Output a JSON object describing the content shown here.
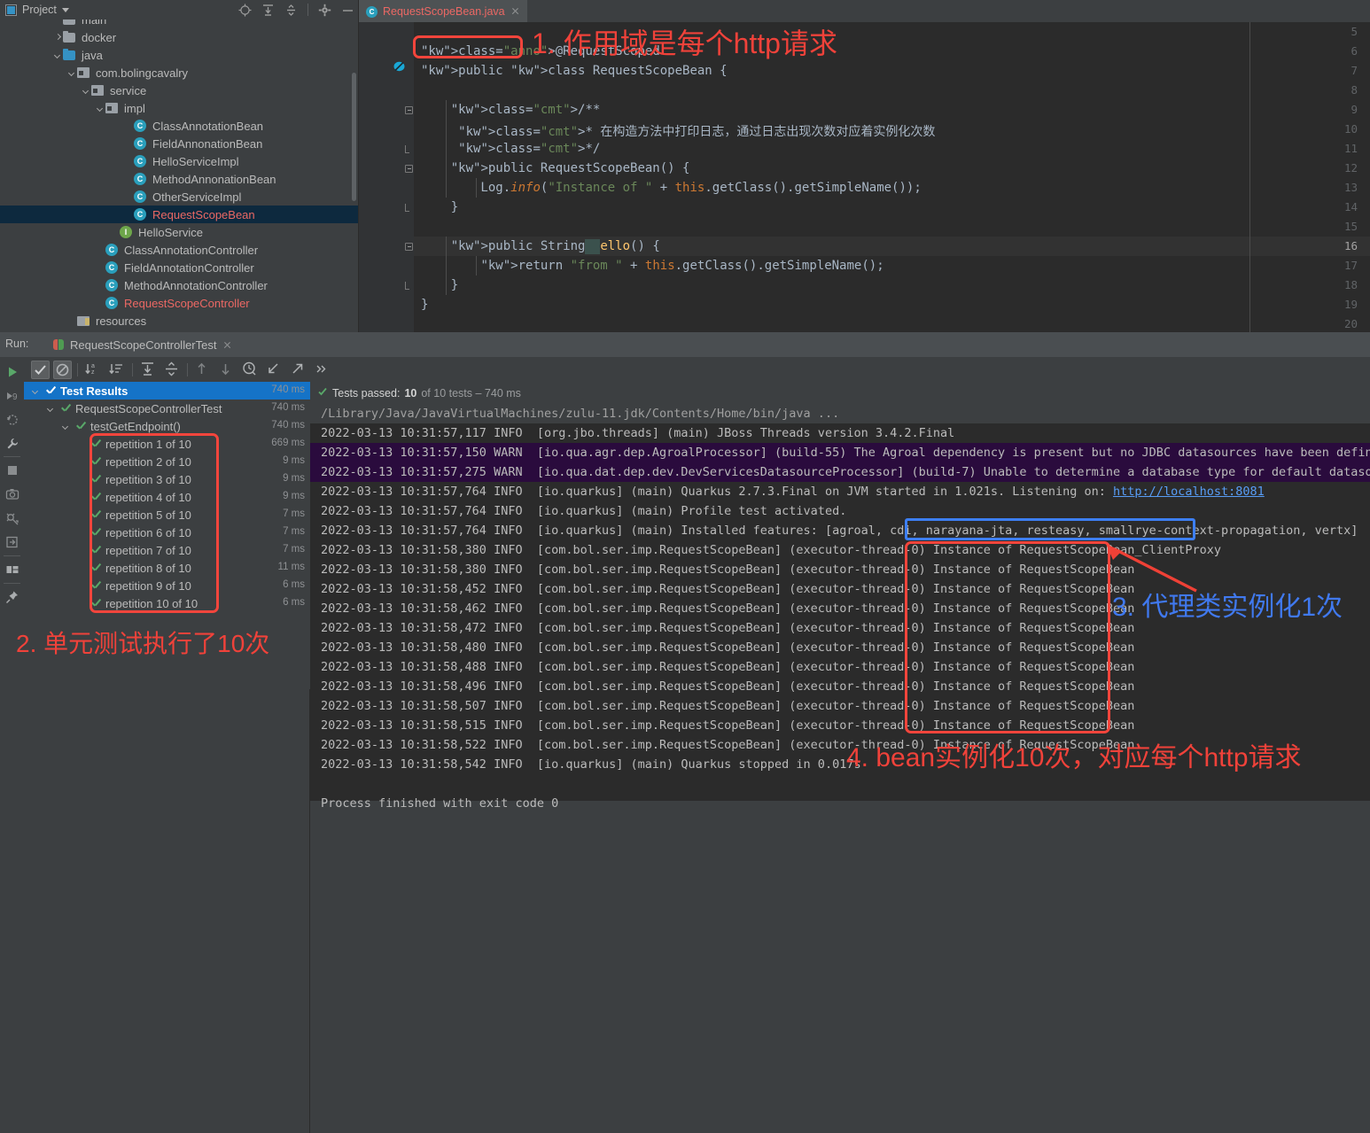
{
  "project_panel": {
    "title": "Project",
    "icons": [
      "locate-icon",
      "expand-all-icon",
      "collapse-all-icon",
      "gear-icon",
      "minimize-icon"
    ],
    "tree": [
      {
        "label": "main",
        "indent": 3,
        "icon": "folder",
        "arrow": "none",
        "cut": true,
        "color": "normal"
      },
      {
        "label": "docker",
        "indent": 3,
        "icon": "folder",
        "arrow": "right",
        "color": "normal"
      },
      {
        "label": "java",
        "indent": 3,
        "icon": "folder-blue",
        "arrow": "down",
        "color": "normal"
      },
      {
        "label": "com.bolingcavalry",
        "indent": 4,
        "icon": "package",
        "arrow": "down",
        "color": "normal"
      },
      {
        "label": "service",
        "indent": 5,
        "icon": "package",
        "arrow": "down",
        "color": "normal"
      },
      {
        "label": "impl",
        "indent": 6,
        "icon": "package",
        "arrow": "down",
        "color": "normal"
      },
      {
        "label": "ClassAnnotationBean",
        "indent": 8,
        "icon": "class",
        "arrow": "none",
        "color": "normal"
      },
      {
        "label": "FieldAnnonationBean",
        "indent": 8,
        "icon": "class",
        "arrow": "none",
        "color": "normal"
      },
      {
        "label": "HelloServiceImpl",
        "indent": 8,
        "icon": "class",
        "arrow": "none",
        "color": "normal"
      },
      {
        "label": "MethodAnnonationBean",
        "indent": 8,
        "icon": "class",
        "arrow": "none",
        "color": "normal"
      },
      {
        "label": "OtherServiceImpl",
        "indent": 8,
        "icon": "class",
        "arrow": "none",
        "color": "normal"
      },
      {
        "label": "RequestScopeBean",
        "indent": 8,
        "icon": "class",
        "arrow": "none",
        "color": "red",
        "selected": true
      },
      {
        "label": "HelloService",
        "indent": 7,
        "icon": "interface",
        "arrow": "none",
        "color": "normal"
      },
      {
        "label": "ClassAnnotationController",
        "indent": 6,
        "icon": "class",
        "arrow": "none",
        "color": "normal"
      },
      {
        "label": "FieldAnnotationController",
        "indent": 6,
        "icon": "class",
        "arrow": "none",
        "color": "normal"
      },
      {
        "label": "MethodAnnotationController",
        "indent": 6,
        "icon": "class",
        "arrow": "none",
        "color": "normal"
      },
      {
        "label": "RequestScopeController",
        "indent": 6,
        "icon": "class",
        "arrow": "none",
        "color": "red"
      },
      {
        "label": "resources",
        "indent": 4,
        "icon": "resources",
        "arrow": "none",
        "color": "normal"
      }
    ]
  },
  "editor": {
    "tab_label": "RequestScopeBean.java",
    "tab_icon": "class-icon",
    "first_line_number": 5,
    "current_line": 16,
    "lines": [
      {
        "n": 5,
        "text": ""
      },
      {
        "n": 6,
        "text": "@RequestScoped"
      },
      {
        "n": 7,
        "text": "public class RequestScopeBean {"
      },
      {
        "n": 8,
        "text": ""
      },
      {
        "n": 9,
        "text": "    /**"
      },
      {
        "n": 10,
        "text": "     * 在构造方法中打印日志，通过日志出现次数对应着实例化次数"
      },
      {
        "n": 11,
        "text": "     */"
      },
      {
        "n": 12,
        "text": "    public RequestScopeBean() {"
      },
      {
        "n": 13,
        "text": "        Log.info(\"Instance of \" + this.getClass().getSimpleName());"
      },
      {
        "n": 14,
        "text": "    }"
      },
      {
        "n": 15,
        "text": ""
      },
      {
        "n": 16,
        "text": "    public String hello() {"
      },
      {
        "n": 17,
        "text": "        return \"from \" + this.getClass().getSimpleName();"
      },
      {
        "n": 18,
        "text": "    }"
      },
      {
        "n": 19,
        "text": "}"
      },
      {
        "n": 20,
        "text": ""
      }
    ]
  },
  "run_panel": {
    "run_label": "Run:",
    "tab_name": "RequestScopeControllerTest",
    "toolbar_icons": [
      "show-passed-toggle",
      "hide-ignored-toggle",
      "sort-alphabetically",
      "sort-by-duration",
      "expand-all",
      "collapse-all",
      "prev-failed",
      "next-failed",
      "history",
      "import-tests",
      "export-tests",
      "more"
    ],
    "left_strip_icons": [
      "rerun-icon",
      "rerun-failed-icon",
      "rerun-automatically-icon",
      "settings-wrench-icon",
      "stop-icon",
      "screenshot-icon",
      "dump-threads-icon",
      "exit-icon",
      "layout-icon",
      "pin-icon"
    ],
    "status_text_prefix": "Tests passed:",
    "status_count": "10",
    "status_text_suffix": "of 10 tests – 740 ms",
    "results": [
      {
        "label": "Test Results",
        "time": "740 ms",
        "indent": 0,
        "arrow": "down",
        "selected": true
      },
      {
        "label": "RequestScopeControllerTest",
        "time": "740 ms",
        "indent": 1,
        "arrow": "down",
        "selected": false
      },
      {
        "label": "testGetEndpoint()",
        "time": "740 ms",
        "indent": 2,
        "arrow": "down",
        "selected": false
      },
      {
        "label": "repetition 1 of 10",
        "time": "669 ms",
        "indent": 3,
        "arrow": "none",
        "selected": false
      },
      {
        "label": "repetition 2 of 10",
        "time": "9 ms",
        "indent": 3,
        "arrow": "none",
        "selected": false
      },
      {
        "label": "repetition 3 of 10",
        "time": "9 ms",
        "indent": 3,
        "arrow": "none",
        "selected": false
      },
      {
        "label": "repetition 4 of 10",
        "time": "9 ms",
        "indent": 3,
        "arrow": "none",
        "selected": false
      },
      {
        "label": "repetition 5 of 10",
        "time": "7 ms",
        "indent": 3,
        "arrow": "none",
        "selected": false
      },
      {
        "label": "repetition 6 of 10",
        "time": "7 ms",
        "indent": 3,
        "arrow": "none",
        "selected": false
      },
      {
        "label": "repetition 7 of 10",
        "time": "7 ms",
        "indent": 3,
        "arrow": "none",
        "selected": false
      },
      {
        "label": "repetition 8 of 10",
        "time": "11 ms",
        "indent": 3,
        "arrow": "none",
        "selected": false
      },
      {
        "label": "repetition 9 of 10",
        "time": "6 ms",
        "indent": 3,
        "arrow": "none",
        "selected": false
      },
      {
        "label": "repetition 10 of 10",
        "time": "6 ms",
        "indent": 3,
        "arrow": "none",
        "selected": false
      }
    ]
  },
  "console": {
    "lines": [
      {
        "style": "first",
        "text": "/Library/Java/JavaVirtualMachines/zulu-11.jdk/Contents/Home/bin/java ..."
      },
      {
        "style": "info",
        "text": "2022-03-13 10:31:57,117 INFO  [org.jbo.threads] (main) JBoss Threads version 3.4.2.Final"
      },
      {
        "style": "warn",
        "text": "2022-03-13 10:31:57,150 WARN  [io.qua.agr.dep.AgroalProcessor] (build-55) The Agroal dependency is present but no JDBC datasources have been defined."
      },
      {
        "style": "warn",
        "text": "2022-03-13 10:31:57,275 WARN  [io.qua.dat.dep.dev.DevServicesDatasourceProcessor] (build-7) Unable to determine a database type for default datasource"
      },
      {
        "style": "link",
        "prefix": "2022-03-13 10:31:57,764 INFO  [io.quarkus] (main) Quarkus 2.7.3.Final on JVM started in 1.021s. Listening on: ",
        "link": "http://localhost:8081"
      },
      {
        "style": "info",
        "text": "2022-03-13 10:31:57,764 INFO  [io.quarkus] (main) Profile test activated."
      },
      {
        "style": "info",
        "text": "2022-03-13 10:31:57,764 INFO  [io.quarkus] (main) Installed features: [agroal, cdi, narayana-jta, resteasy, smallrye-context-propagation, vertx]"
      },
      {
        "style": "info",
        "text": "2022-03-13 10:31:58,380 INFO  [com.bol.ser.imp.RequestScopeBean] (executor-thread-0) Instance of RequestScopeBean_ClientProxy"
      },
      {
        "style": "info",
        "text": "2022-03-13 10:31:58,380 INFO  [com.bol.ser.imp.RequestScopeBean] (executor-thread-0) Instance of RequestScopeBean"
      },
      {
        "style": "info",
        "text": "2022-03-13 10:31:58,452 INFO  [com.bol.ser.imp.RequestScopeBean] (executor-thread-0) Instance of RequestScopeBean"
      },
      {
        "style": "info",
        "text": "2022-03-13 10:31:58,462 INFO  [com.bol.ser.imp.RequestScopeBean] (executor-thread-0) Instance of RequestScopeBean"
      },
      {
        "style": "info",
        "text": "2022-03-13 10:31:58,472 INFO  [com.bol.ser.imp.RequestScopeBean] (executor-thread-0) Instance of RequestScopeBean"
      },
      {
        "style": "info",
        "text": "2022-03-13 10:31:58,480 INFO  [com.bol.ser.imp.RequestScopeBean] (executor-thread-0) Instance of RequestScopeBean"
      },
      {
        "style": "info",
        "text": "2022-03-13 10:31:58,488 INFO  [com.bol.ser.imp.RequestScopeBean] (executor-thread-0) Instance of RequestScopeBean"
      },
      {
        "style": "info",
        "text": "2022-03-13 10:31:58,496 INFO  [com.bol.ser.imp.RequestScopeBean] (executor-thread-0) Instance of RequestScopeBean"
      },
      {
        "style": "info",
        "text": "2022-03-13 10:31:58,507 INFO  [com.bol.ser.imp.RequestScopeBean] (executor-thread-0) Instance of RequestScopeBean"
      },
      {
        "style": "info",
        "text": "2022-03-13 10:31:58,515 INFO  [com.bol.ser.imp.RequestScopeBean] (executor-thread-0) Instance of RequestScopeBean"
      },
      {
        "style": "info",
        "text": "2022-03-13 10:31:58,522 INFO  [com.bol.ser.imp.RequestScopeBean] (executor-thread-0) Instance of RequestScopeBean"
      },
      {
        "style": "info",
        "text": "2022-03-13 10:31:58,542 INFO  [io.quarkus] (main) Quarkus stopped in 0.017s"
      },
      {
        "style": "blank",
        "text": ""
      },
      {
        "style": "info",
        "text": "Process finished with exit code 0"
      }
    ]
  },
  "annotations": {
    "red_color": "#f0423a",
    "blue_color": "#4079ef",
    "note1": "1. 作用域是每个http请求",
    "note2": "2. 单元测试执行了10次",
    "note3": "3. 代理类实例化1次",
    "note4": "4. bean实例化10次，对应每个http请求"
  }
}
